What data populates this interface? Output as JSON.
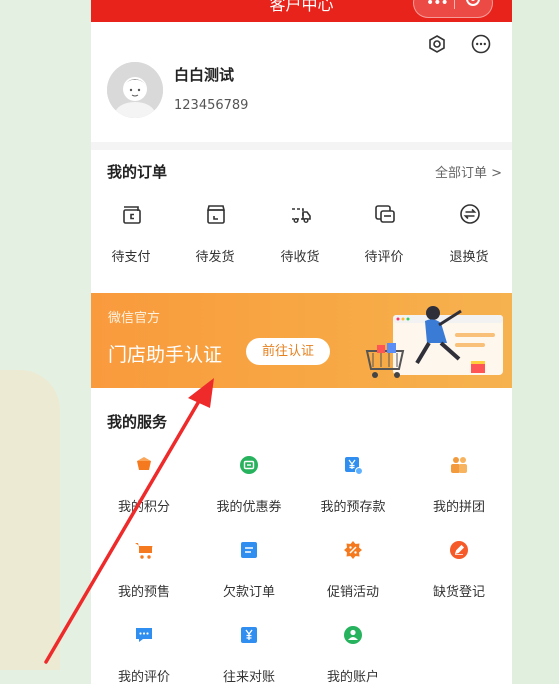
{
  "header": {
    "title": "客户中心"
  },
  "profile": {
    "name": "白白测试",
    "id": "123456789"
  },
  "orders": {
    "title": "我的订单",
    "all_label": "全部订单 >",
    "items": [
      {
        "label": "待支付",
        "icon": "wallet-icon"
      },
      {
        "label": "待发货",
        "icon": "package-icon"
      },
      {
        "label": "待收货",
        "icon": "delivery-truck-icon"
      },
      {
        "label": "待评价",
        "icon": "review-icon"
      },
      {
        "label": "退换货",
        "icon": "exchange-icon"
      }
    ]
  },
  "banner": {
    "subtitle": "微信官方",
    "title": "门店助手认证",
    "button": "前往认证"
  },
  "services": {
    "title": "我的服务",
    "items": [
      {
        "label": "我的积分",
        "icon": "points-icon",
        "color": "#f57a1f"
      },
      {
        "label": "我的优惠券",
        "icon": "coupon-icon",
        "color": "#27b25e"
      },
      {
        "label": "我的预存款",
        "icon": "deposit-icon",
        "color": "#2f8ef0"
      },
      {
        "label": "我的拼团",
        "icon": "group-buy-icon",
        "color": "#f39a3c"
      },
      {
        "label": "我的预售",
        "icon": "presale-cart-icon",
        "color": "#f57a1f"
      },
      {
        "label": "欠款订单",
        "icon": "debt-order-icon",
        "color": "#2f8ef0"
      },
      {
        "label": "促销活动",
        "icon": "promotion-icon",
        "color": "#f57a1f"
      },
      {
        "label": "缺货登记",
        "icon": "stockout-icon",
        "color": "#f55a28"
      },
      {
        "label": "我的评价",
        "icon": "comment-icon",
        "color": "#2f8ef0"
      },
      {
        "label": "往来对账",
        "icon": "reconcile-icon",
        "color": "#2f8ef0"
      },
      {
        "label": "我的账户",
        "icon": "account-icon",
        "color": "#27b25e"
      }
    ]
  },
  "colors": {
    "brand_red": "#e8231b",
    "annotation_arrow": "#ee2a2a"
  }
}
